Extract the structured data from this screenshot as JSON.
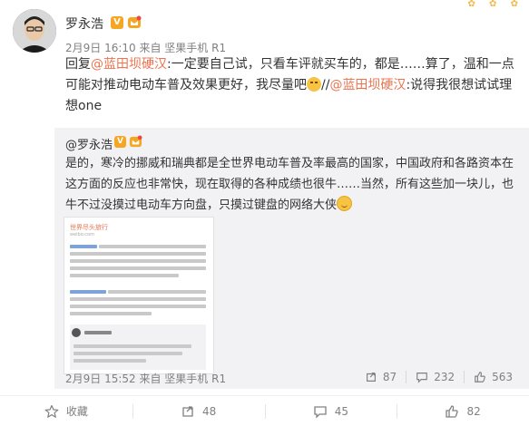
{
  "post": {
    "author": "罗永浩",
    "meta": "2月9日 16:10 来自 坚果手机 R1",
    "reply_prefix": "回复",
    "mention1": "@蓝田坝硬汉",
    "text1": ":一定要自己试，只看车评就买车的，都是……算了，温和一点可能对推动电动车普及效果更好，我尽量吧",
    "sep": "//",
    "mention2": "@蓝田坝硬汉",
    "text2": ":说得我很想试试理想one"
  },
  "repost": {
    "author": "@罗永浩",
    "text": "是的，寒冷的挪威和瑞典都是全世界电动车普及率最高的国家，中国政府和各路资本在这方面的反应也非常快，现在取得的各种成绩也很牛……当然，所有这些加一块儿，也牛不过没摸过电动车方向盘，只摸过键盘的网络大侠",
    "meta": "2月9日 15:52 来自 坚果手机 R1",
    "share_count": "87",
    "comment_count": "232",
    "like_count": "563",
    "image": {
      "title": "世界尽头旅行",
      "subtitle": "weibo.com",
      "author": "@罗永浩"
    }
  },
  "footer": {
    "favorite_label": "收藏",
    "share_count": "48",
    "comment_count": "45",
    "like_count": "82"
  },
  "colors": {
    "mention": "#eb7350",
    "badge": "#f6a623",
    "repost_bg": "#f2f2f5",
    "meta": "#808080"
  }
}
